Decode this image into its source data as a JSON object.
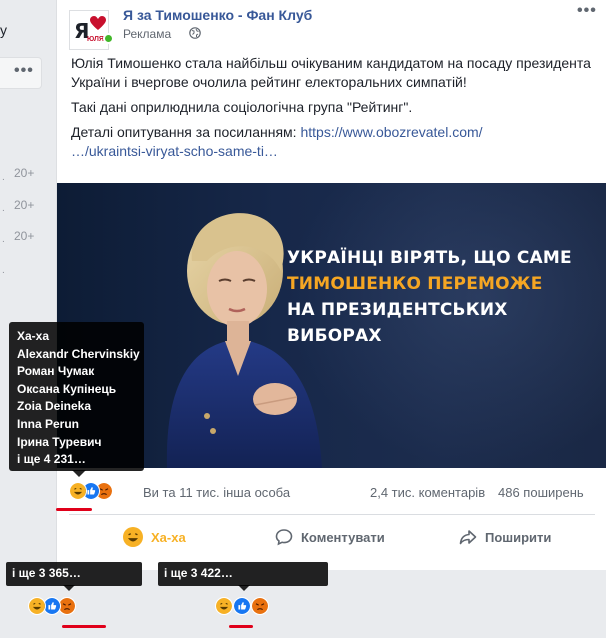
{
  "sidebar": {
    "partial_label": "у",
    "more_label": "•••",
    "counts": [
      "20+",
      "20+",
      "20+"
    ],
    "ticks": [
      ".",
      ".",
      ".",
      "."
    ]
  },
  "post": {
    "page_name": "Я за Тимошенко - Фан Клуб",
    "sponsored_label": "Реклама",
    "more_label": "•••",
    "avatar": {
      "letter": "Я",
      "sub": "ЮЛЯ",
      "accent": "#c8102e"
    },
    "text": {
      "p1": "Юлія Тимошенко стала найбільш очікуваним кандидатом на посаду президента України і вчергове очолила рейтинг електоральних симпатій!",
      "p2": "Такі дані оприлюднила соціологічна група \"Рейтинг\".",
      "p3_prefix": "Деталі опитування за посиланням: ",
      "link_line1": "https://www.obozrevatel.com/",
      "link_line2": "…/ukraintsi-viryat-scho-same-ti…"
    },
    "image": {
      "headline_line1": "УКРАЇНЦІ ВІРЯТЬ, ЩО САМЕ",
      "headline_line2": "ТИМОШЕНКО ПЕРЕМОЖЕ",
      "headline_line3": "НА ПРЕЗИДЕНТСЬКИХ ВИБОРАХ",
      "accent_color": "#f5a623"
    },
    "summary": {
      "reactions_text": "Ви та 11 тис. інша особа",
      "comments_text": "2,4 тис. коментарів",
      "shares_text": "486 поширень"
    },
    "actions": {
      "haha_label": "Ха-ха",
      "comment_label": "Коментувати",
      "share_label": "Поширити"
    }
  },
  "tooltip": {
    "title": "Ха-ха",
    "names": [
      "Alexandr Chervinskiy",
      "Роман Чумак",
      "Оксана Купінець",
      "Zoia Deineka",
      "Inna Perun",
      "Ірина Туревич"
    ],
    "more": "і ще 4 231…"
  },
  "crops": {
    "left_tip": "і ще 3 365…",
    "right_tip": "і ще 3 422…"
  },
  "colors": {
    "link": "#385898",
    "haha": "#f7b125",
    "like": "#1877f2",
    "angry": "#e9710f",
    "underline": "#e0001a"
  }
}
